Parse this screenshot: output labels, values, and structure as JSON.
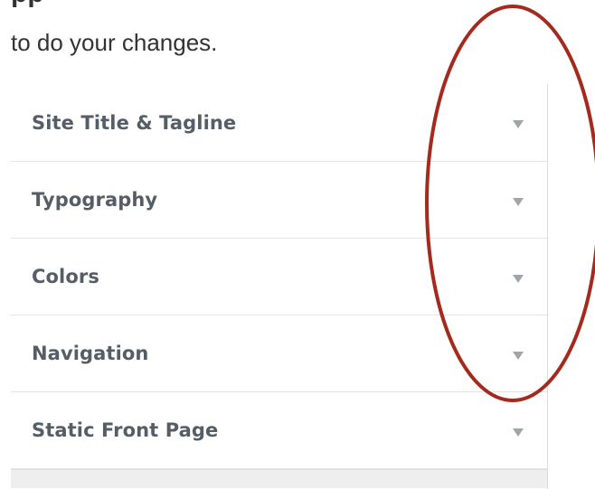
{
  "intro": {
    "heading_fragment": "pp",
    "text": "to do your changes."
  },
  "customizer": {
    "sections": [
      {
        "label": "Site Title & Tagline",
        "icon": "arrow-down-icon"
      },
      {
        "label": "Typography",
        "icon": "arrow-down-icon"
      },
      {
        "label": "Colors",
        "icon": "arrow-down-icon"
      },
      {
        "label": "Navigation",
        "icon": "arrow-down-icon"
      },
      {
        "label": "Static Front Page",
        "icon": "arrow-down-icon"
      }
    ]
  },
  "colors": {
    "annotation_circle": "#a52a1e",
    "section_text": "#555d66",
    "arrow": "#a0a5aa"
  }
}
